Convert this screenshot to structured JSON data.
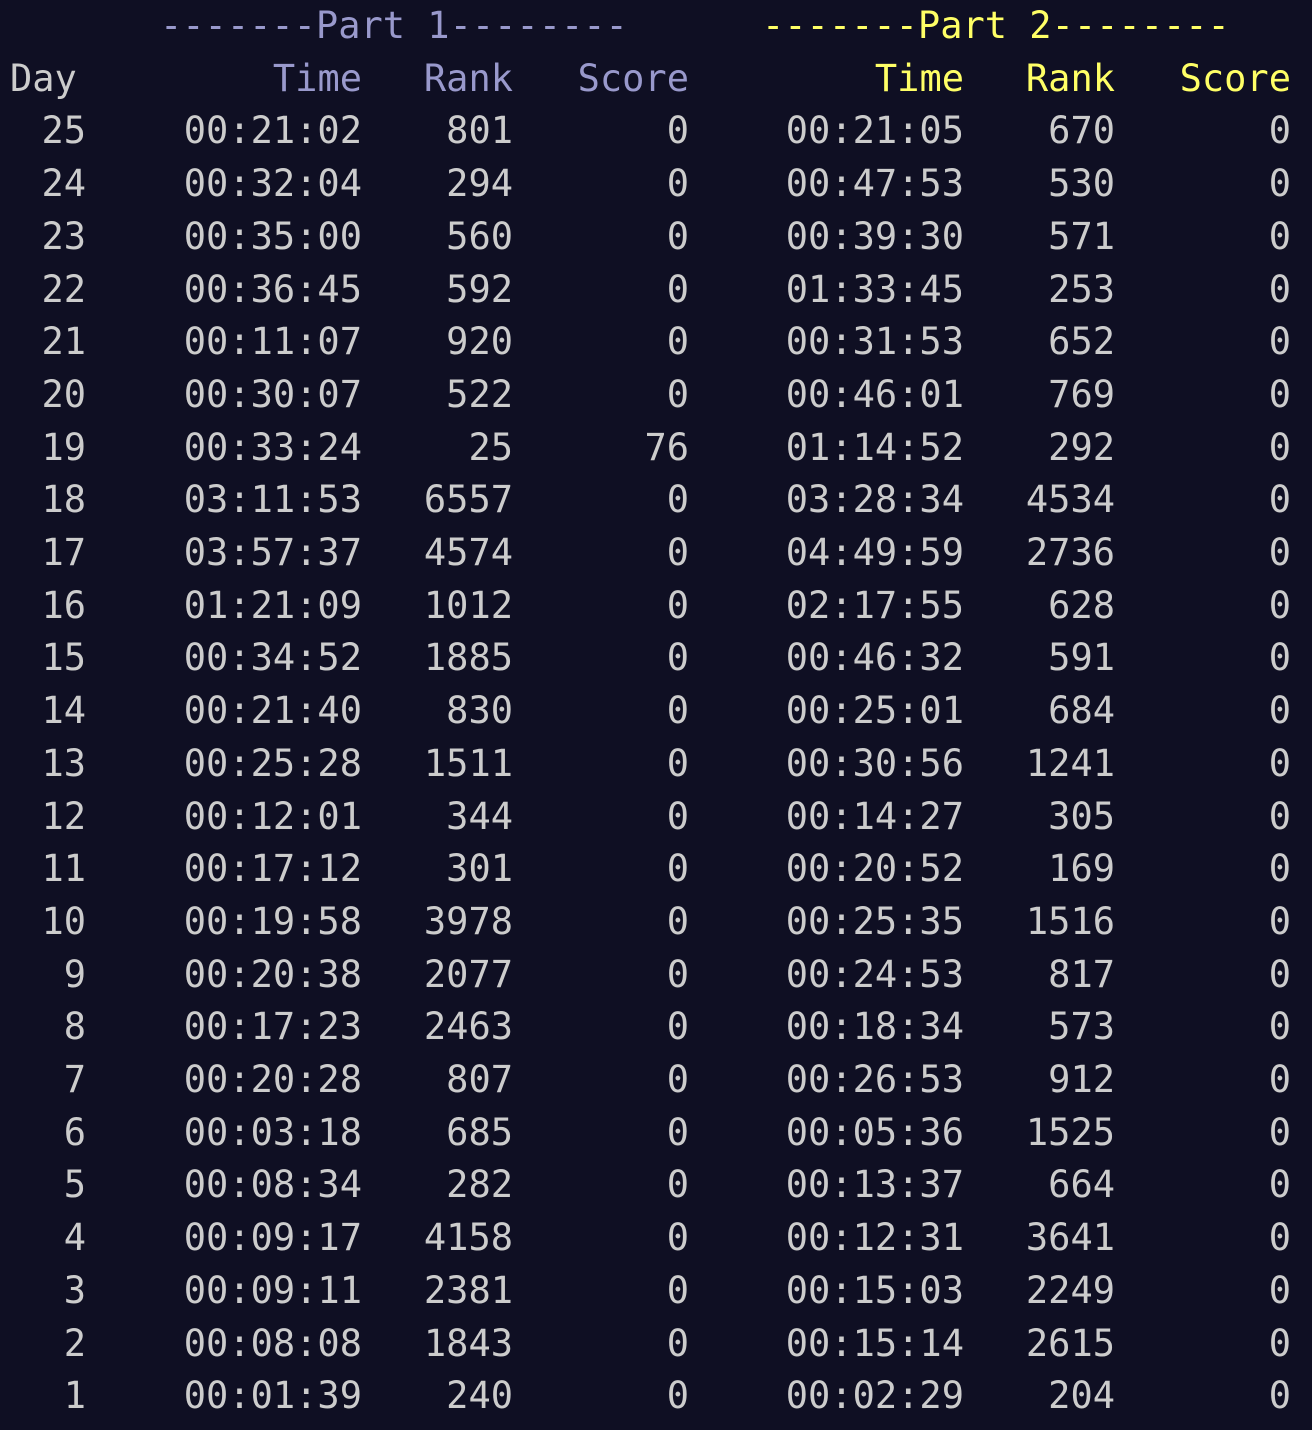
{
  "part1": {
    "label": "-------Part 1--------",
    "color": "#9999cc"
  },
  "part2": {
    "label": "-------Part 2--------",
    "color": "#ffff66"
  },
  "headers": {
    "day": "Day",
    "time1": "Time",
    "rank1": "Rank",
    "score1": "Score",
    "time2": "Time",
    "rank2": "Rank",
    "score2": "Score"
  },
  "rows": [
    {
      "day": "25",
      "time1": "00:21:02",
      "rank1": "801",
      "score1": "0",
      "time2": "00:21:05",
      "rank2": "670",
      "score2": "0"
    },
    {
      "day": "24",
      "time1": "00:32:04",
      "rank1": "294",
      "score1": "0",
      "time2": "00:47:53",
      "rank2": "530",
      "score2": "0"
    },
    {
      "day": "23",
      "time1": "00:35:00",
      "rank1": "560",
      "score1": "0",
      "time2": "00:39:30",
      "rank2": "571",
      "score2": "0"
    },
    {
      "day": "22",
      "time1": "00:36:45",
      "rank1": "592",
      "score1": "0",
      "time2": "01:33:45",
      "rank2": "253",
      "score2": "0"
    },
    {
      "day": "21",
      "time1": "00:11:07",
      "rank1": "920",
      "score1": "0",
      "time2": "00:31:53",
      "rank2": "652",
      "score2": "0"
    },
    {
      "day": "20",
      "time1": "00:30:07",
      "rank1": "522",
      "score1": "0",
      "time2": "00:46:01",
      "rank2": "769",
      "score2": "0"
    },
    {
      "day": "19",
      "time1": "00:33:24",
      "rank1": "25",
      "score1": "76",
      "time2": "01:14:52",
      "rank2": "292",
      "score2": "0"
    },
    {
      "day": "18",
      "time1": "03:11:53",
      "rank1": "6557",
      "score1": "0",
      "time2": "03:28:34",
      "rank2": "4534",
      "score2": "0"
    },
    {
      "day": "17",
      "time1": "03:57:37",
      "rank1": "4574",
      "score1": "0",
      "time2": "04:49:59",
      "rank2": "2736",
      "score2": "0"
    },
    {
      "day": "16",
      "time1": "01:21:09",
      "rank1": "1012",
      "score1": "0",
      "time2": "02:17:55",
      "rank2": "628",
      "score2": "0"
    },
    {
      "day": "15",
      "time1": "00:34:52",
      "rank1": "1885",
      "score1": "0",
      "time2": "00:46:32",
      "rank2": "591",
      "score2": "0"
    },
    {
      "day": "14",
      "time1": "00:21:40",
      "rank1": "830",
      "score1": "0",
      "time2": "00:25:01",
      "rank2": "684",
      "score2": "0"
    },
    {
      "day": "13",
      "time1": "00:25:28",
      "rank1": "1511",
      "score1": "0",
      "time2": "00:30:56",
      "rank2": "1241",
      "score2": "0"
    },
    {
      "day": "12",
      "time1": "00:12:01",
      "rank1": "344",
      "score1": "0",
      "time2": "00:14:27",
      "rank2": "305",
      "score2": "0"
    },
    {
      "day": "11",
      "time1": "00:17:12",
      "rank1": "301",
      "score1": "0",
      "time2": "00:20:52",
      "rank2": "169",
      "score2": "0"
    },
    {
      "day": "10",
      "time1": "00:19:58",
      "rank1": "3978",
      "score1": "0",
      "time2": "00:25:35",
      "rank2": "1516",
      "score2": "0"
    },
    {
      "day": "9",
      "time1": "00:20:38",
      "rank1": "2077",
      "score1": "0",
      "time2": "00:24:53",
      "rank2": "817",
      "score2": "0"
    },
    {
      "day": "8",
      "time1": "00:17:23",
      "rank1": "2463",
      "score1": "0",
      "time2": "00:18:34",
      "rank2": "573",
      "score2": "0"
    },
    {
      "day": "7",
      "time1": "00:20:28",
      "rank1": "807",
      "score1": "0",
      "time2": "00:26:53",
      "rank2": "912",
      "score2": "0"
    },
    {
      "day": "6",
      "time1": "00:03:18",
      "rank1": "685",
      "score1": "0",
      "time2": "00:05:36",
      "rank2": "1525",
      "score2": "0"
    },
    {
      "day": "5",
      "time1": "00:08:34",
      "rank1": "282",
      "score1": "0",
      "time2": "00:13:37",
      "rank2": "664",
      "score2": "0"
    },
    {
      "day": "4",
      "time1": "00:09:17",
      "rank1": "4158",
      "score1": "0",
      "time2": "00:12:31",
      "rank2": "3641",
      "score2": "0"
    },
    {
      "day": "3",
      "time1": "00:09:11",
      "rank1": "2381",
      "score1": "0",
      "time2": "00:15:03",
      "rank2": "2249",
      "score2": "0"
    },
    {
      "day": "2",
      "time1": "00:08:08",
      "rank1": "1843",
      "score1": "0",
      "time2": "00:15:14",
      "rank2": "2615",
      "score2": "0"
    },
    {
      "day": "1",
      "time1": "00:01:39",
      "rank1": "240",
      "score1": "0",
      "time2": "00:02:29",
      "rank2": "204",
      "score2": "0"
    }
  ]
}
